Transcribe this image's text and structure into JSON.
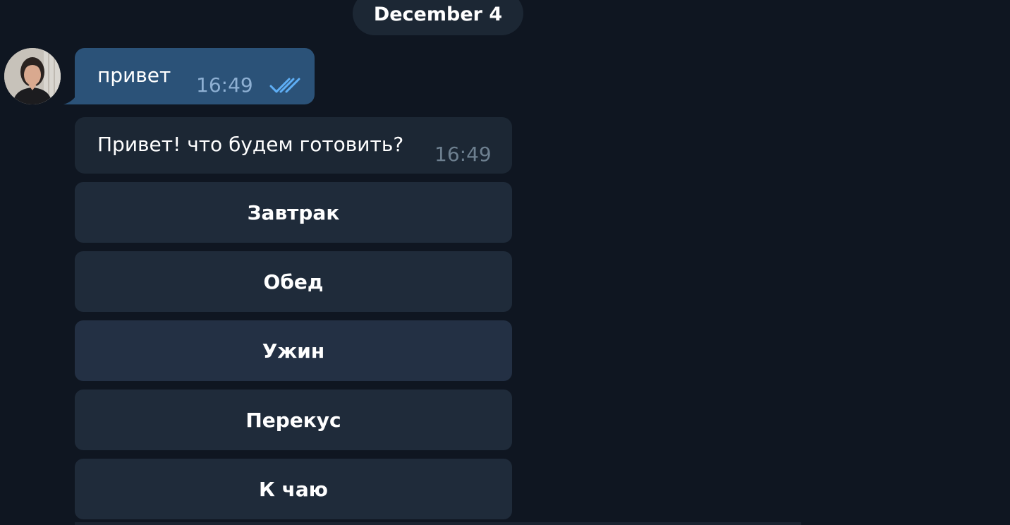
{
  "date_label": "December 4",
  "outgoing_message": {
    "text": "привет",
    "time": "16:49",
    "status_icon": "double-check-icon"
  },
  "incoming_message": {
    "text": "Привет! что будем готовить?",
    "time": "16:49"
  },
  "keyboard": {
    "buttons": [
      "Завтрак",
      "Обед",
      "Ужин",
      "Перекус",
      "К чаю"
    ]
  },
  "colors": {
    "background": "#0f1621",
    "outgoing_bubble": "#2b5278",
    "incoming_bubble": "#1c2734",
    "keyboard_button": "#1f2b3a",
    "read_check": "#5eaef5"
  }
}
